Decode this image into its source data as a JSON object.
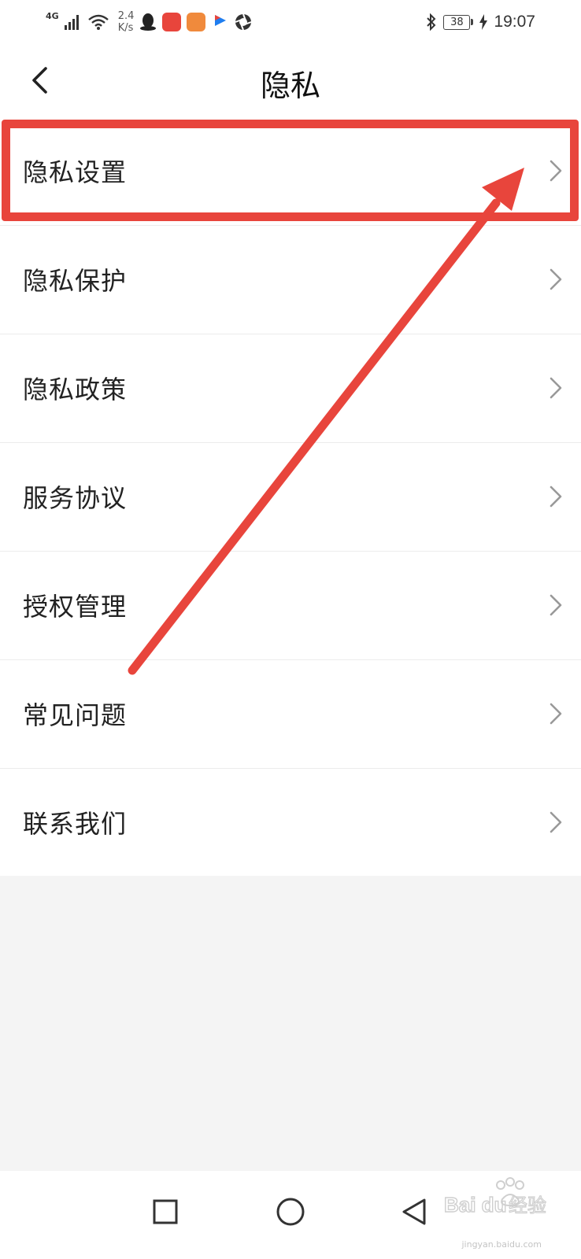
{
  "status_bar": {
    "network_type": "4G",
    "speed_value": "2.4",
    "speed_unit": "K/s",
    "battery_level": "38",
    "time": "19:07",
    "icons": [
      "signal-icon",
      "wifi-icon",
      "qq-icon",
      "huawei-app-icon",
      "health-app-icon",
      "youku-icon",
      "aperture-app-icon",
      "bluetooth-icon",
      "battery-icon",
      "charging-icon"
    ],
    "badge_colors": {
      "huawei": "#e8453c",
      "health": "#f08a3c"
    }
  },
  "header": {
    "title": "隐私",
    "back_icon": "chevron-left-icon"
  },
  "menu": {
    "items": [
      {
        "label": "隐私设置",
        "highlighted": true
      },
      {
        "label": "隐私保护"
      },
      {
        "label": "隐私政策"
      },
      {
        "label": "服务协议"
      },
      {
        "label": "授权管理"
      },
      {
        "label": "常见问题"
      },
      {
        "label": "联系我们"
      }
    ],
    "item_icon": "chevron-right-icon"
  },
  "annotation": {
    "color": "#e8453c",
    "shapes": [
      "highlight-box",
      "arrow"
    ]
  },
  "navbar": {
    "icons": [
      "square-recents-icon",
      "circle-home-icon",
      "triangle-back-icon"
    ]
  },
  "watermark": {
    "text": "jingyan.baidu.com",
    "logo": "Baidu 经验"
  }
}
